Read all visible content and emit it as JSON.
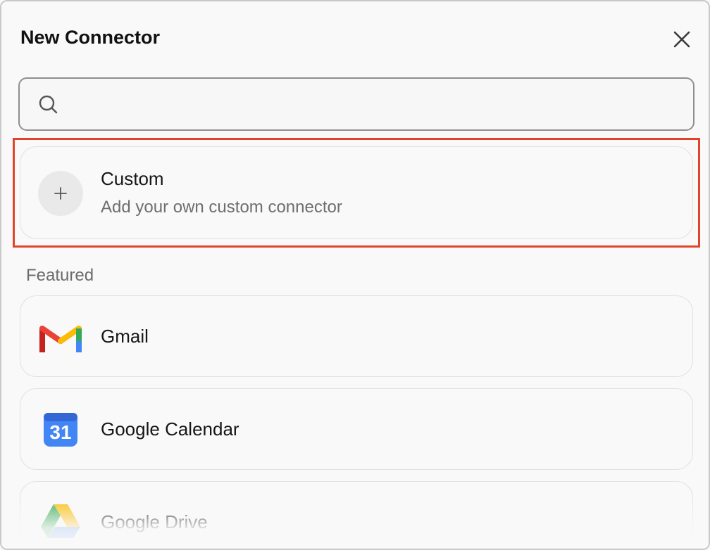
{
  "dialog": {
    "title": "New Connector",
    "close_icon": "close-icon"
  },
  "search": {
    "icon": "search-icon",
    "value": "",
    "placeholder": ""
  },
  "custom": {
    "icon": "plus-icon",
    "title": "Custom",
    "subtitle": "Add your own custom connector"
  },
  "featured": {
    "label": "Featured",
    "items": [
      {
        "icon": "gmail-logo",
        "label": "Gmail"
      },
      {
        "icon": "google-calendar-logo",
        "label": "Google Calendar",
        "icon_text": "31"
      },
      {
        "icon": "google-drive-logo",
        "label": "Google Drive"
      }
    ]
  },
  "colors": {
    "highlight": "#e2442b",
    "background": "#f9f9f9",
    "card_border": "#e1e1e1"
  }
}
